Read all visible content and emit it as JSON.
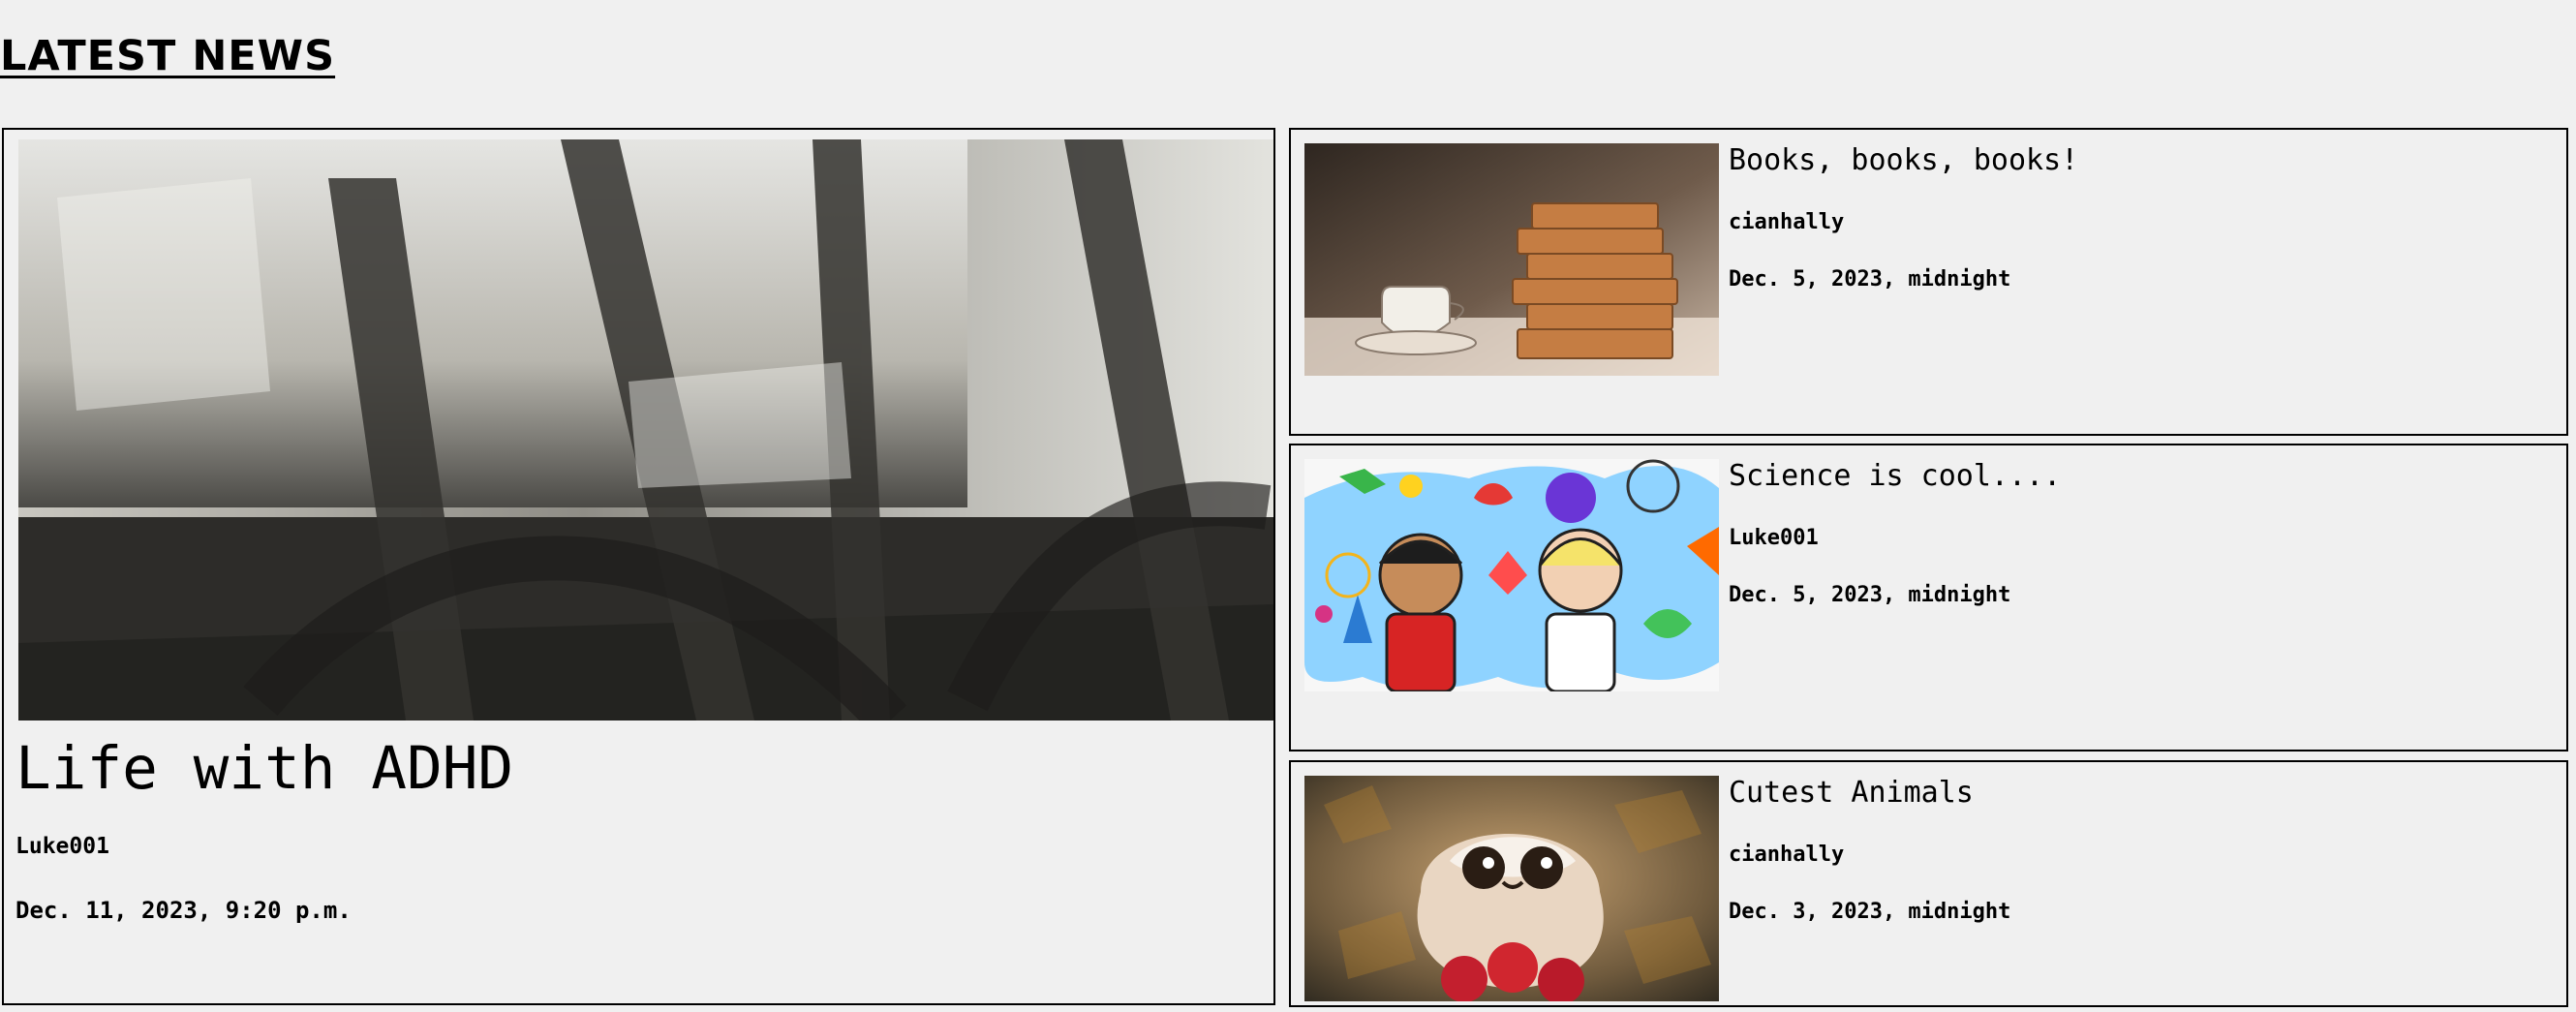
{
  "section": {
    "heading": "LATEST NEWS"
  },
  "featured": {
    "image_alt": "wagon-wheels-photo",
    "title": "Life with ADHD",
    "author": "Luke001",
    "date": "Dec. 11, 2023, 9:20 p.m."
  },
  "cards": [
    {
      "image_alt": "books-and-coffee-photo",
      "title": "Books, books, books!",
      "author": "cianhally",
      "date": "Dec. 5, 2023, midnight"
    },
    {
      "image_alt": "science-illustration",
      "title": "Science is cool....",
      "author": "Luke001",
      "date": "Dec. 5, 2023, midnight"
    },
    {
      "image_alt": "slow-loris-photo",
      "title": "Cutest Animals",
      "author": "cianhally",
      "date": "Dec. 3, 2023, midnight"
    }
  ],
  "colors": {
    "background": "#f0f0f0",
    "border": "#000000",
    "text": "#000000"
  }
}
